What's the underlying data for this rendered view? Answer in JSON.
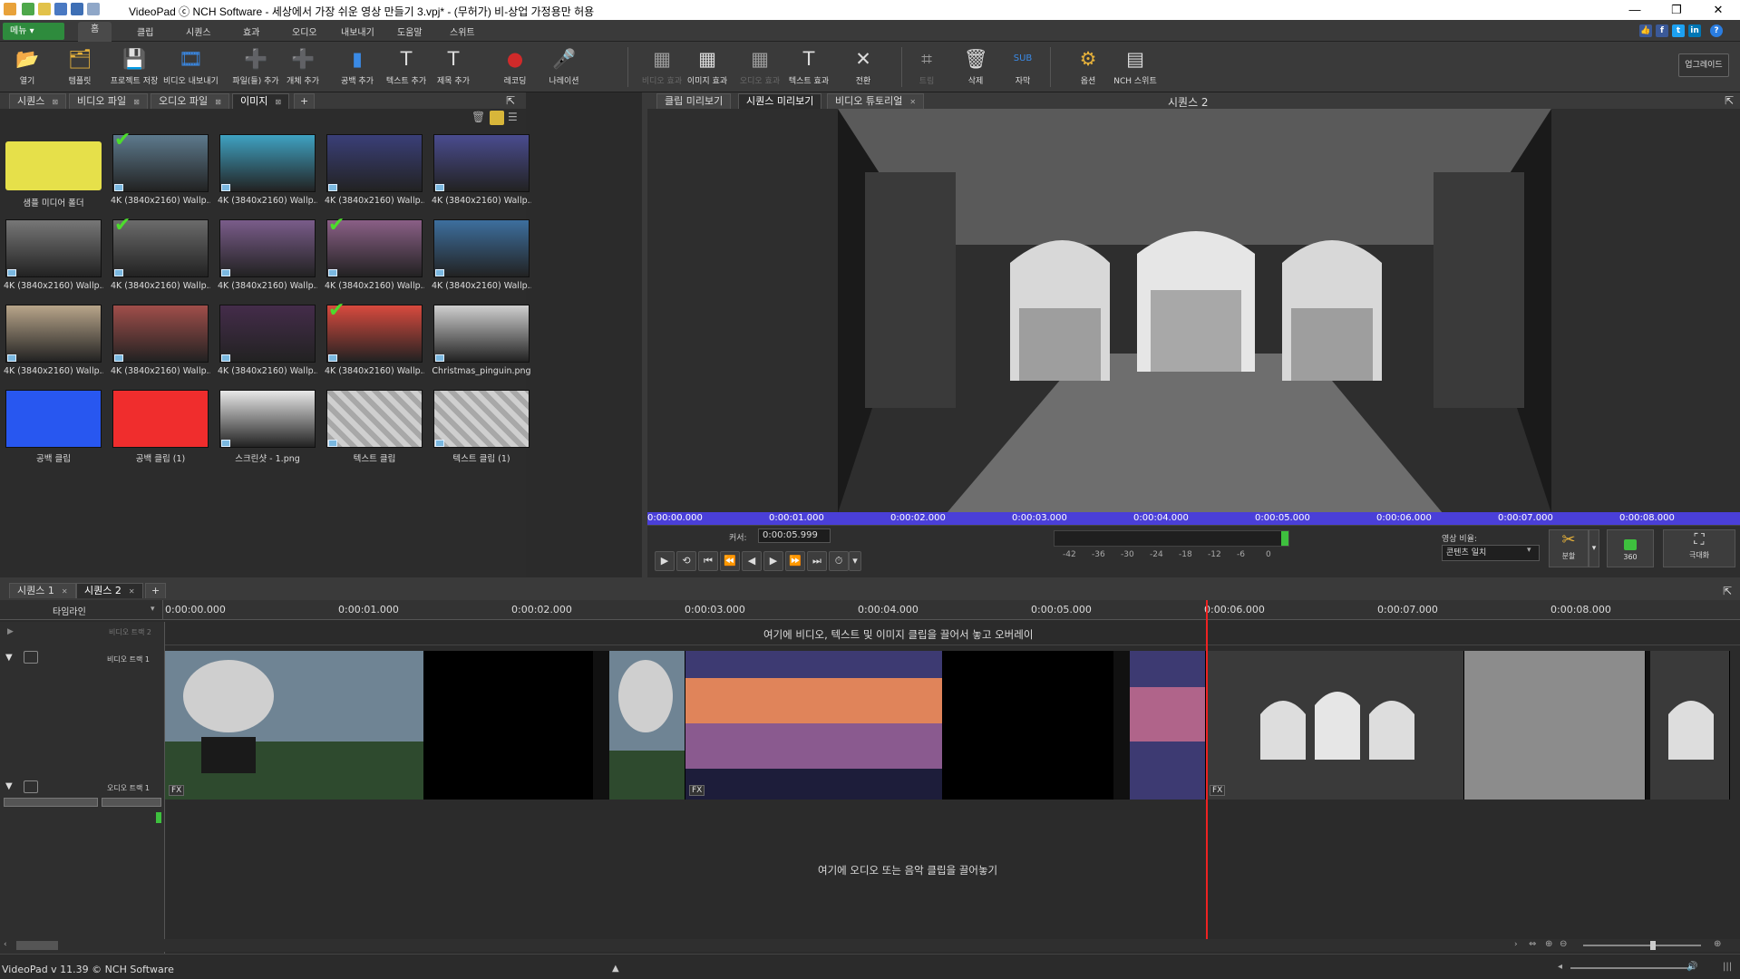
{
  "window": {
    "title": "VideoPad ⓒ NCH Software - 세상에서 가장 쉬운 영상 만들기 3.vpj* - (무허가) 비-상업 가정용만 허용",
    "minimize": "—",
    "restore": "❐",
    "close": "✕"
  },
  "menubar": {
    "menu_button": "메뉴 ▾",
    "tabs": [
      "홈",
      "클립",
      "시퀀스",
      "효과",
      "오디오",
      "내보내기",
      "도움말",
      "스위트"
    ]
  },
  "toolbar": {
    "upgrade": "업그레이드",
    "buttons": [
      {
        "label": "열기",
        "icon": "folder-open-icon",
        "glyph": "📂"
      },
      {
        "label": "템플릿",
        "icon": "template-icon",
        "glyph": "🗂"
      },
      {
        "label": "프로젝트 저장",
        "icon": "save-icon",
        "glyph": "💾"
      },
      {
        "label": "비디오 내보내기",
        "icon": "export-video-icon",
        "glyph": "🎞"
      },
      {
        "label": "파일(들) 추가",
        "icon": "add-files-icon",
        "glyph": "➕"
      },
      {
        "label": "개체 추가",
        "icon": "add-object-icon",
        "glyph": "➕"
      },
      {
        "label": "공백 추가",
        "icon": "add-blank-icon",
        "glyph": "▮"
      },
      {
        "label": "텍스트 추가",
        "icon": "add-text-icon",
        "glyph": "T"
      },
      {
        "label": "제목 추가",
        "icon": "add-title-icon",
        "glyph": "T"
      },
      {
        "label": "레코딩",
        "icon": "record-icon",
        "glyph": "●"
      },
      {
        "label": "나레이션",
        "icon": "narration-icon",
        "glyph": "🎤"
      },
      {
        "label": "비디오 효과",
        "icon": "video-effect-icon",
        "glyph": "▦"
      },
      {
        "label": "이미지 효과",
        "icon": "image-effect-icon",
        "glyph": "▦"
      },
      {
        "label": "오디오 효과",
        "icon": "audio-effect-icon",
        "glyph": "▦"
      },
      {
        "label": "텍스트 효과",
        "icon": "text-effect-icon",
        "glyph": "T"
      },
      {
        "label": "전환",
        "icon": "transition-icon",
        "glyph": "✕"
      },
      {
        "label": "트림",
        "icon": "trim-icon",
        "glyph": "⌗"
      },
      {
        "label": "삭제",
        "icon": "delete-icon",
        "glyph": "🗑"
      },
      {
        "label": "자막",
        "icon": "subtitle-icon",
        "glyph": "SUB"
      },
      {
        "label": "옵션",
        "icon": "options-icon",
        "glyph": "⚙"
      },
      {
        "label": "NCH 스위트",
        "icon": "nch-suite-icon",
        "glyph": "▤"
      }
    ]
  },
  "bins": {
    "tabs": [
      "시퀀스",
      "비디오 파일",
      "오디오 파일",
      "이미지"
    ],
    "add": "+",
    "items": [
      {
        "caption": "샘플 미디어 폴더",
        "color": "#e6e04a",
        "kind": "folder",
        "checked": false
      },
      {
        "caption": "4K (3840x2160) Wallp...",
        "color": "#5d7a8d",
        "kind": "img",
        "checked": true
      },
      {
        "caption": "4K (3840x2160) Wallp...",
        "color": "#3fa2c2",
        "kind": "img",
        "checked": false
      },
      {
        "caption": "4K (3840x2160) Wallp...",
        "color": "#3a3f78",
        "kind": "img",
        "checked": false
      },
      {
        "caption": "4K (3840x2160) Wallp...",
        "color": "#4a4c8f",
        "kind": "img",
        "checked": false
      },
      {
        "caption": "4K (3840x2160) Wallp...",
        "color": "#777777",
        "kind": "img",
        "checked": false
      },
      {
        "caption": "4K (3840x2160) Wallp...",
        "color": "#6b6b6b",
        "kind": "img",
        "checked": true
      },
      {
        "caption": "4K (3840x2160) Wallp...",
        "color": "#7a5c8a",
        "kind": "img",
        "checked": false
      },
      {
        "caption": "4K (3840x2160) Wallp...",
        "color": "#8a5f86",
        "kind": "img",
        "checked": true
      },
      {
        "caption": "4K (3840x2160) Wallp...",
        "color": "#3d6f9e",
        "kind": "img",
        "checked": false
      },
      {
        "caption": "4K (3840x2160) Wallp...",
        "color": "#b8a58a",
        "kind": "img",
        "checked": false
      },
      {
        "caption": "4K (3840x2160) Wallp...",
        "color": "#a04e4a",
        "kind": "img",
        "checked": false
      },
      {
        "caption": "4K (3840x2160) Wallp...",
        "color": "#442c4a",
        "kind": "img",
        "checked": false
      },
      {
        "caption": "4K (3840x2160) Wallp...",
        "color": "#d84a3e",
        "kind": "img",
        "checked": true
      },
      {
        "caption": "Christmas_pinguin.png",
        "color": "#cfcfcf",
        "kind": "img",
        "checked": false
      },
      {
        "caption": "공백 클립",
        "color": "#2857f0",
        "kind": "blank",
        "checked": false
      },
      {
        "caption": "공백 클립 (1)",
        "color": "#f02d2d",
        "kind": "blank",
        "checked": false
      },
      {
        "caption": "스크린샷 - 1.png",
        "color": "#e8e8e8",
        "kind": "img",
        "checked": false
      },
      {
        "caption": "텍스트 클립",
        "color": "#bfbfbf",
        "kind": "text",
        "checked": false
      },
      {
        "caption": "텍스트 클립 (1)",
        "color": "#bfbfbf",
        "kind": "text",
        "checked": false
      }
    ]
  },
  "preview": {
    "tabs": [
      "클립 미리보기",
      "시퀀스 미리보기",
      "비디오 튜토리얼"
    ],
    "sequence_title": "시퀀스 2",
    "ruler": [
      "0:00:00.000",
      "0:00:01.000",
      "0:00:02.000",
      "0:00:03.000",
      "0:00:04.000",
      "0:00:05.000",
      "0:00:06.000",
      "0:00:07.000",
      "0:00:08.000"
    ],
    "cursor_label": "커서:",
    "cursor_value": "0:00:05.999",
    "meter_ticks": [
      "-42",
      "-36",
      "-30",
      "-24",
      "-18",
      "-12",
      "-6",
      "0"
    ],
    "aspect_label": "영상 비율:",
    "aspect_value": "콘텐츠 일치",
    "split_label": "분할",
    "vr_label": "360",
    "fullscreen_label": "극대화"
  },
  "timeline": {
    "tabs": [
      "시퀀스 1",
      "시퀀스 2"
    ],
    "add": "+",
    "mode": "타임라인",
    "ruler": [
      "0:00:00.000",
      "0:00:01.000",
      "0:00:02.000",
      "0:00:03.000",
      "0:00:04.000",
      "0:00:05.000",
      "0:00:06.000",
      "0:00:07.000",
      "0:00:08.000"
    ],
    "video_track_2": "비디오 트랙 2",
    "video_track_1": "비디오 트랙 1",
    "audio_track_1": "오디오 트랙 1",
    "overlay_hint": "여기에 비디오, 텍스트 및 이미지 클립을 끌어서 놓고 오버레이",
    "audio_hint": "여기에 오디오 또는 음악 클립을 끌어놓기",
    "fx": "FX"
  },
  "status": {
    "version": "VideoPad v 11.39 © NCH Software"
  }
}
